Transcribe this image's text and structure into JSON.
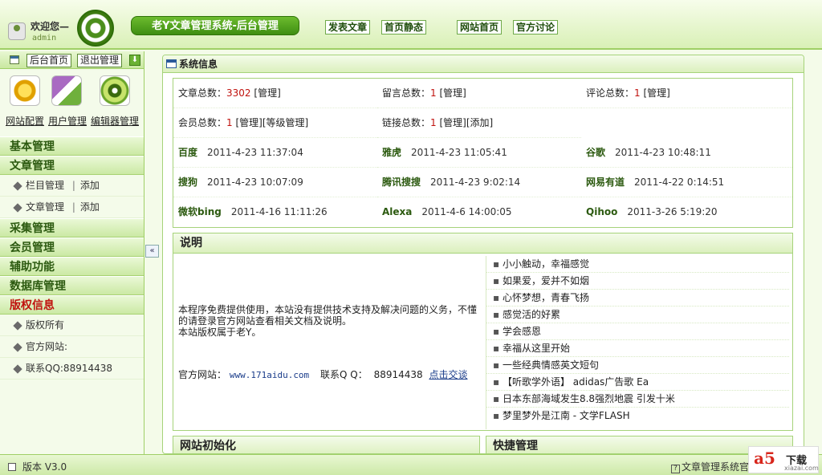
{
  "header": {
    "welcome": "欢迎您—",
    "username": "admin",
    "system_title": "老Y文章管理系统-后台管理",
    "nav": [
      "发表文章",
      "首页静态",
      "网站首页",
      "官方讨论"
    ]
  },
  "sidebar": {
    "top_buttons": [
      "后台首页",
      "退出管理"
    ],
    "down_icon": "⬇",
    "tools": [
      "网站配置",
      "用户管理",
      "编辑器管理"
    ],
    "collapse": "«",
    "menu": {
      "basic": "基本管理",
      "article": "文章管理",
      "article_items": [
        {
          "label": "栏目管理",
          "sep": "|",
          "action": "添加"
        },
        {
          "label": "文章管理",
          "sep": "|",
          "action": "添加"
        }
      ],
      "collect": "采集管理",
      "member": "会员管理",
      "assist": "辅助功能",
      "database": "数据库管理",
      "copyright": "版权信息",
      "copyright_items": [
        "版权所有",
        "官方网站:",
        "联系QQ:88914438"
      ]
    }
  },
  "main": {
    "title": "系统信息",
    "stats": {
      "articles_label": "文章总数：",
      "articles": "3302",
      "articles_manage": "[管理]",
      "messages_label": "留言总数：",
      "messages": "1",
      "messages_manage": "[管理]",
      "comments_label": "评论总数：",
      "comments": "1",
      "comments_manage": "[管理]",
      "members_label": "会员总数：",
      "members": "1",
      "members_manage": "[管理][等级管理]",
      "links_label": "链接总数：",
      "links": "1",
      "links_manage": "[管理][添加]"
    },
    "spiders": [
      {
        "name": "百度",
        "time": "2011-4-23 11:37:04"
      },
      {
        "name": "雅虎",
        "time": "2011-4-23 11:05:41"
      },
      {
        "name": "谷歌",
        "time": "2011-4-23 10:48:11"
      },
      {
        "name": "搜狗",
        "time": "2011-4-23 10:07:09"
      },
      {
        "name": "腾讯搜搜",
        "time": "2011-4-23 9:02:14"
      },
      {
        "name": "网易有道",
        "time": "2011-4-22 0:14:51"
      },
      {
        "name": "微软bing",
        "time": "2011-4-16 11:11:26"
      },
      {
        "name": "Alexa",
        "time": "2011-4-6 14:00:05"
      },
      {
        "name": "Qihoo",
        "time": "2011-3-26 5:19:20"
      }
    ],
    "desc": {
      "title": "说明",
      "text1": "本程序免费提供使用，本站没有提供技术支持及解决问题的义务，不懂的请登录官方网站查看相关文档及说明。",
      "text2": "本站版权属于老Y。",
      "site_label": "官方网站：",
      "site_url": "www.171aidu.com",
      "qq_label": "联系Q Q：",
      "qq": "88914438",
      "talk": "点击交谈",
      "news": [
        "小小触动，幸福感觉",
        "如果爱，爱并不如烟",
        "心怀梦想，青春飞扬",
        "感觉活的好累",
        "学会感恩",
        "幸福从这里开始",
        "一些经典情感英文短句",
        "【听歌学外语】 adidas广告歌 Ea",
        "日本东部海域发生8.8强烈地震 引发十米",
        "梦里梦外是江南 - 文学FLASH"
      ]
    },
    "init_title": "网站初始化",
    "quick_title": "快捷管理"
  },
  "footer": {
    "version": "版本 V3.0",
    "help": "?",
    "right": "文章管理系统官"
  },
  "watermark": {
    "logo": "a5",
    "download": "下载",
    "site": "xiazai.com"
  },
  "colors": {
    "accent": "#3f8e12",
    "red": "#c0120e",
    "border": "#a6d37a"
  }
}
